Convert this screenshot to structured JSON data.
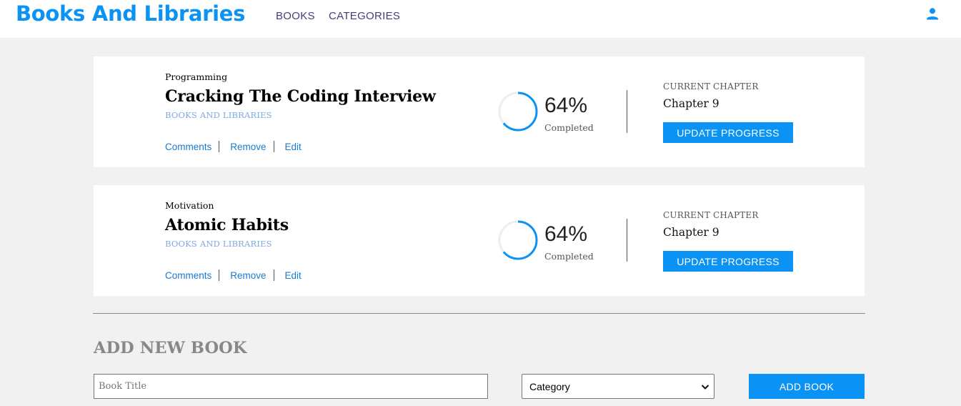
{
  "header": {
    "brand": "Books And Libraries",
    "nav": [
      {
        "label": "BOOKS"
      },
      {
        "label": "CATEGORIES"
      }
    ],
    "user_icon": "user-icon",
    "accent_color": "#0a93f5"
  },
  "books": [
    {
      "category": "Programming",
      "title": "Cracking The Coding Interview",
      "author": "BOOKS AND LIBRARIES",
      "actions": {
        "comments": "Comments",
        "remove": "Remove",
        "edit": "Edit"
      },
      "progress": {
        "percent_text": "64%",
        "percent": 64,
        "label": "Completed"
      },
      "current_chapter": {
        "label": "CURRENT CHAPTER",
        "value": "Chapter 9"
      },
      "update_label": "UPDATE PROGRESS"
    },
    {
      "category": "Motivation",
      "title": "Atomic Habits",
      "author": "BOOKS AND LIBRARIES",
      "actions": {
        "comments": "Comments",
        "remove": "Remove",
        "edit": "Edit"
      },
      "progress": {
        "percent_text": "64%",
        "percent": 64,
        "label": "Completed"
      },
      "current_chapter": {
        "label": "CURRENT CHAPTER",
        "value": "Chapter 9"
      },
      "update_label": "UPDATE PROGRESS"
    }
  ],
  "add_book": {
    "title": "ADD NEW BOOK",
    "title_placeholder": "Book Title",
    "title_value": "",
    "category_selected": "Category",
    "submit_label": "ADD BOOK"
  }
}
